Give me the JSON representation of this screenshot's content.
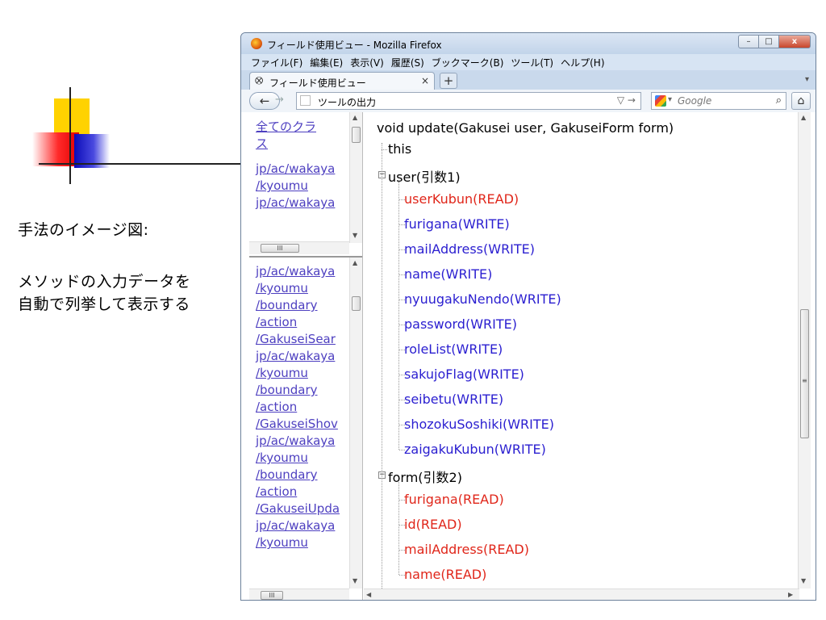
{
  "slide": {
    "caption_title": "手法のイメージ図:",
    "caption_line1": "メソッドの入力データを",
    "caption_line2": "自動で列挙して表示する"
  },
  "window": {
    "title": "フィールド使用ビュー - Mozilla Firefox",
    "minimize": "–",
    "maximize": "□",
    "close": "x"
  },
  "menu": [
    "ファイル(F)",
    "編集(E)",
    "表示(V)",
    "履歴(S)",
    "ブックマーク(B)",
    "ツール(T)",
    "ヘルプ(H)"
  ],
  "tab": {
    "title": "フィールド使用ビュー",
    "close": "×",
    "new": "+"
  },
  "nav": {
    "url": "ツールの出力",
    "search_placeholder": "Google"
  },
  "left_top_links": [
    "全てのクラ",
    "ス",
    "jp/ac/wakaya",
    "/kyoumu",
    "jp/ac/wakaya"
  ],
  "left_bottom_links": [
    "jp/ac/wakaya",
    "/kyoumu",
    "/boundary",
    "/action",
    "/GakuseiSear",
    "jp/ac/wakaya",
    "/kyoumu",
    "/boundary",
    "/action",
    "/GakuseiShov",
    "jp/ac/wakaya",
    "/kyoumu",
    "/boundary",
    "/action",
    "/GakuseiUpda",
    "jp/ac/wakaya",
    "/kyoumu"
  ],
  "tree": {
    "signature": "void update(Gakusei user, GakuseiForm form)",
    "this_label": "this",
    "params": [
      {
        "label": "user(引数1)",
        "fields": [
          {
            "name": "userKubun(READ)",
            "mode": "READ"
          },
          {
            "name": "furigana(WRITE)",
            "mode": "WRITE"
          },
          {
            "name": "mailAddress(WRITE)",
            "mode": "WRITE"
          },
          {
            "name": "name(WRITE)",
            "mode": "WRITE"
          },
          {
            "name": "nyuugakuNendo(WRITE)",
            "mode": "WRITE"
          },
          {
            "name": "password(WRITE)",
            "mode": "WRITE"
          },
          {
            "name": "roleList(WRITE)",
            "mode": "WRITE"
          },
          {
            "name": "sakujoFlag(WRITE)",
            "mode": "WRITE"
          },
          {
            "name": "seibetu(WRITE)",
            "mode": "WRITE"
          },
          {
            "name": "shozokuSoshiki(WRITE)",
            "mode": "WRITE"
          },
          {
            "name": "zaigakuKubun(WRITE)",
            "mode": "WRITE"
          }
        ]
      },
      {
        "label": "form(引数2)",
        "fields": [
          {
            "name": "furigana(READ)",
            "mode": "READ"
          },
          {
            "name": "id(READ)",
            "mode": "READ"
          },
          {
            "name": "mailAddress(READ)",
            "mode": "READ"
          },
          {
            "name": "name(READ)",
            "mode": "READ"
          }
        ]
      }
    ]
  },
  "colors": {
    "read": "#e0261a",
    "write": "#2a1ed0",
    "link": "#4d3fc0"
  }
}
